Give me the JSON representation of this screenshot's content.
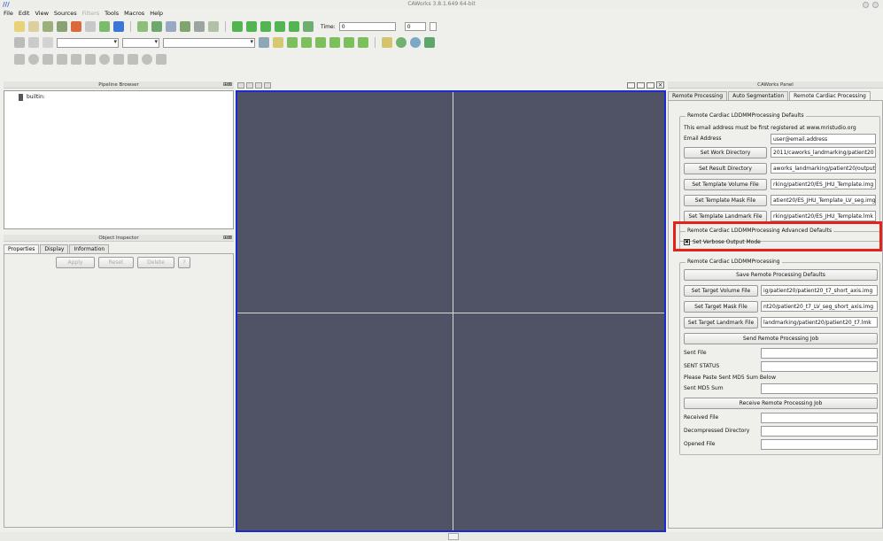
{
  "window": {
    "title": "CAWorks 3.8.1.649 64-bit"
  },
  "menu": [
    "File",
    "Edit",
    "View",
    "Sources",
    "Filters",
    "Tools",
    "Macros",
    "Help"
  ],
  "toolbar": {
    "time_label": "Time:",
    "time_value": "0",
    "time_index": "0"
  },
  "pipeline_browser": {
    "title": "Pipeline Browser",
    "root_item": "builtin:"
  },
  "object_inspector": {
    "title": "Object Inspector",
    "tabs": [
      "Properties",
      "Display",
      "Information"
    ],
    "apply": "Apply",
    "reset": "Reset",
    "delete": "Delete",
    "help": "?"
  },
  "caworks_panel": {
    "title": "CAWorks Panel",
    "tabs": [
      "Remote Processing",
      "Auto Segmentation",
      "Remote Cardiac Processing"
    ],
    "defaults": {
      "title": "Remote Cardiac LDDMMProcessing Defaults",
      "note": "This email address must be first registered at www.mristudio.org",
      "email_label": "Email Address",
      "email_value": "user@email.address",
      "rows": [
        {
          "button": "Set Work Directory",
          "value": "2011/caworks_landmarking/patient20"
        },
        {
          "button": "Set Result Directory",
          "value": "aworks_landmarking/patient20/output"
        },
        {
          "button": "Set Template Volume File",
          "value": "rking/patient20/ES_JHU_Template.img"
        },
        {
          "button": "Set Template Mask File",
          "value": "atient20/ES_JHU_Template_LV_seg.img"
        },
        {
          "button": "Set Template Landmark File",
          "value": "rking/patient20/ES_JHU_Template.lmk"
        }
      ]
    },
    "advanced": {
      "title": "Remote Cardiac LDDMMProcessing Advanced Defaults",
      "verbose_label": "Set Verbose Output Mode"
    },
    "processing": {
      "title": "Remote Cardiac LDDMMProcessing",
      "save_defaults": "Save Remote Processing Defaults",
      "rows": [
        {
          "button": "Set Target Volume File",
          "value": "ig/patient20/patient20_t7_short_axis.img"
        },
        {
          "button": "Set Target Mask File",
          "value": "nt20/patient20_t7_LV_seg_short_axis.img"
        },
        {
          "button": "Set Target Landmark File",
          "value": "landmarking/patient20/patient20_t7.lmk"
        }
      ],
      "send_job": "Send Remote Processing Job",
      "sent_file": "Sent File",
      "sent_status": "SENT STATUS",
      "paste_note": "Please Paste Sent MD5 Sum Below",
      "sent_md5": "Sent MD5 Sum",
      "receive_job": "Receive Remote Processing Job",
      "received_file": "Received File",
      "decompressed_dir": "Decompressed Directory",
      "opened_file": "Opened File"
    }
  }
}
